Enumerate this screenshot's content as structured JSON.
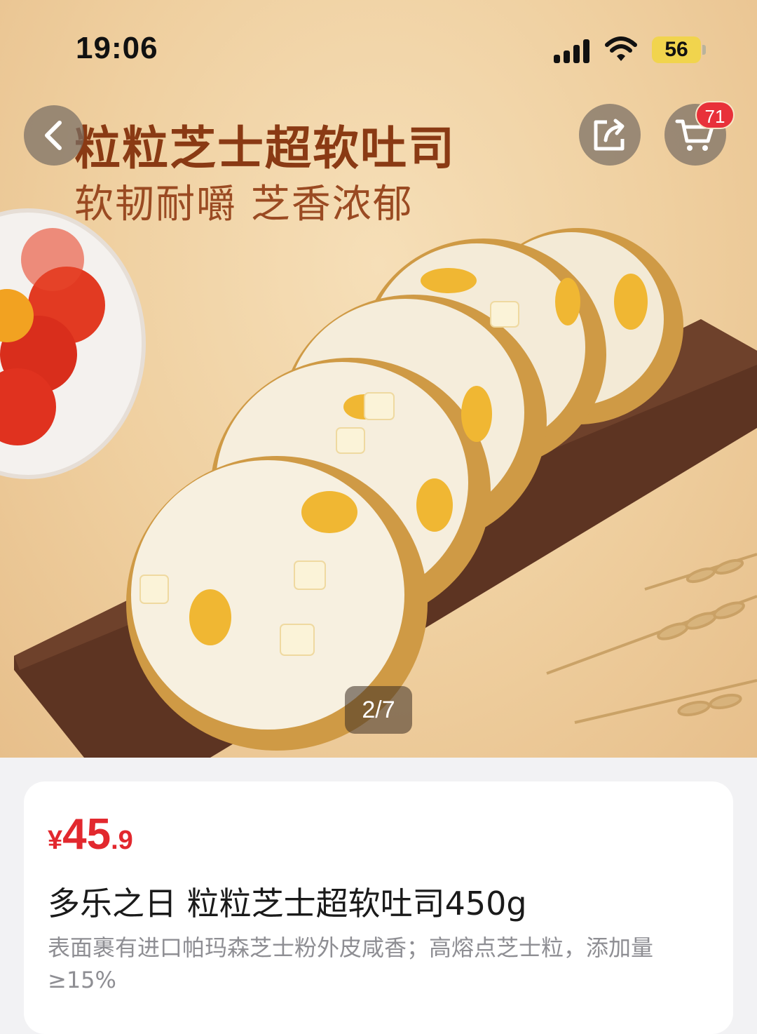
{
  "status_bar": {
    "time": "19:06",
    "battery": "56",
    "icons": [
      "signal-icon",
      "wifi-icon",
      "battery-icon"
    ]
  },
  "header": {
    "back_icon": "chevron-left-icon",
    "share_icon": "share-icon",
    "cart_icon": "cart-icon",
    "cart_badge": "71"
  },
  "hero": {
    "title": "粒粒芝士超软吐司",
    "subtitle": "软韧耐嚼 芝香浓郁",
    "page_indicator": "2/7"
  },
  "product": {
    "currency": "¥",
    "price_integer": "45",
    "price_decimal": ".9",
    "title": "多乐之日 粒粒芝士超软吐司450g",
    "description": "表面裹有进口帕玛森芝士粉外皮咸香；高熔点芝士粒，添加量≥15%"
  },
  "colors": {
    "price": "#e2282e",
    "badge": "#e8313a",
    "hero_title": "#8a3a14"
  }
}
